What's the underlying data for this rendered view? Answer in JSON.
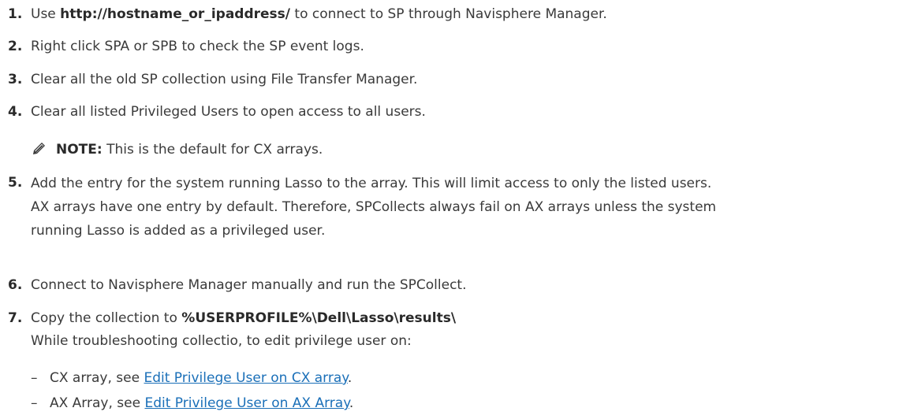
{
  "steps": [
    {
      "number": "1.",
      "pre": "Use ",
      "bold": "http://hostname_or_ipaddress/",
      "post": " to connect to SP through Navisphere Manager."
    },
    {
      "number": "2.",
      "text": "Right click SPA or SPB to check the SP event logs."
    },
    {
      "number": "3.",
      "text": "Clear all the old SP collection using File Transfer Manager."
    },
    {
      "number": "4.",
      "text": "Clear all listed Privileged Users to open access to all users."
    },
    {
      "number": "5.",
      "lines": [
        "Add the entry for the system running Lasso to the array. This will limit access to only the listed users.",
        "AX arrays have one entry by default. Therefore, SPCollects always fail on AX arrays unless the system",
        "running Lasso is added as a privileged user."
      ]
    },
    {
      "number": "6.",
      "text": "Connect to Navisphere Manager manually and run the SPCollect."
    },
    {
      "number": "7.",
      "pre": "Copy the collection to ",
      "bold": "%USERPROFILE%\\Dell\\Lasso\\results\\",
      "line2": "While troubleshooting collectio, to edit privilege user on:"
    }
  ],
  "note": {
    "label": "NOTE:",
    "text": " This is the default for CX arrays.",
    "icon": "pencil-note-icon"
  },
  "bullets": [
    {
      "dash": "–",
      "pre": "CX array, see ",
      "link": "Edit Privilege User on CX array",
      "post": "."
    },
    {
      "dash": "–",
      "pre": "AX Array, see ",
      "link": "Edit Privilege User on AX Array",
      "post": "."
    }
  ],
  "colors": {
    "text": "#3a3a3a",
    "link": "#1a6fb8"
  }
}
